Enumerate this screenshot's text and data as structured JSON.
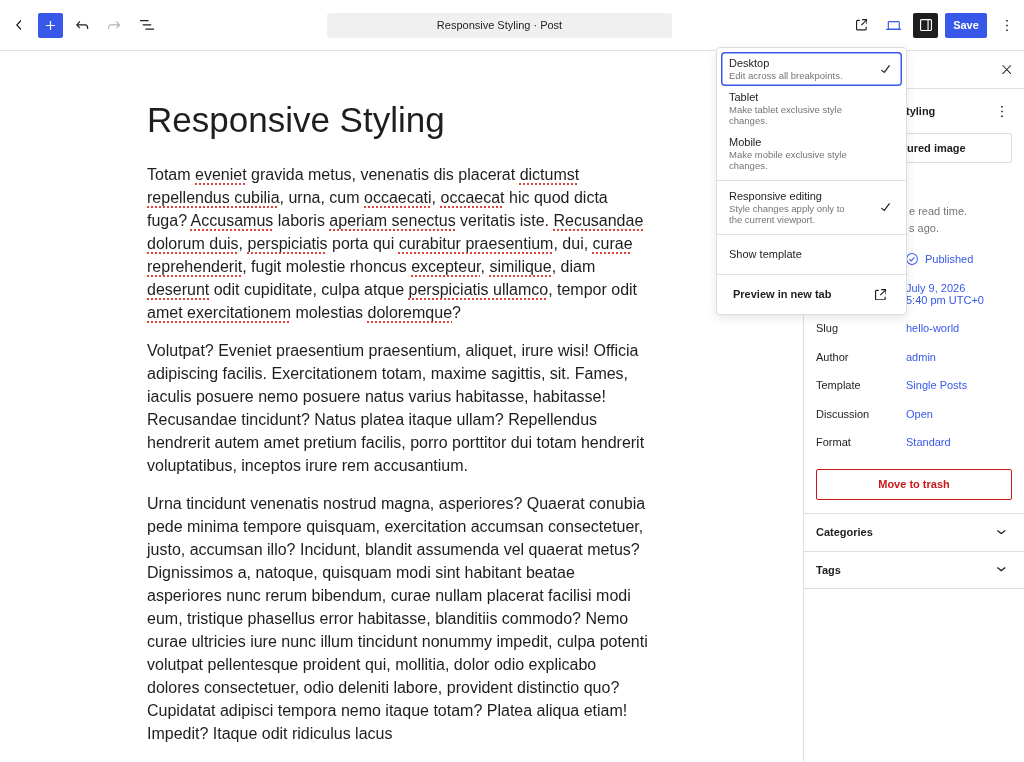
{
  "top_bar": {
    "left_tools": [
      {
        "kind": "back",
        "disabled": false
      },
      {
        "kind": "add",
        "disabled": false
      },
      {
        "kind": "undo",
        "disabled": false
      },
      {
        "kind": "redo",
        "disabled": true
      },
      {
        "kind": "outline",
        "disabled": false
      }
    ],
    "document_title": "Responsive Styling · Post",
    "right_tools": [
      {
        "kind": "external",
        "pressed": false
      },
      {
        "kind": "device",
        "pressed": true
      },
      {
        "kind": "sidebar",
        "pressed": true
      },
      {
        "kind": "save",
        "label": "Save"
      },
      {
        "kind": "more",
        "pressed": false
      }
    ]
  },
  "editor": {
    "title": "Responsive Styling",
    "paragraphs": [
      {
        "segments": [
          {
            "text": "Totam ",
            "flagged": false
          },
          {
            "text": "eveniet",
            "flagged": true
          },
          {
            "text": " gravida metus, venenatis dis placerat ",
            "flagged": false
          },
          {
            "text": "dictumst repellendus cubilia",
            "flagged": true
          },
          {
            "text": ", urna, cum ",
            "flagged": false
          },
          {
            "text": "occaecati",
            "flagged": true
          },
          {
            "text": ", ",
            "flagged": false
          },
          {
            "text": "occaecat",
            "flagged": true
          },
          {
            "text": " hic quod dicta fuga? ",
            "flagged": false
          },
          {
            "text": "Accusamus",
            "flagged": true
          },
          {
            "text": " laboris ",
            "flagged": false
          },
          {
            "text": "aperiam senectus",
            "flagged": true
          },
          {
            "text": " veritatis iste. ",
            "flagged": false
          },
          {
            "text": "Recusandae dolorum duis",
            "flagged": true
          },
          {
            "text": ", ",
            "flagged": false
          },
          {
            "text": "perspiciatis",
            "flagged": true
          },
          {
            "text": " porta qui ",
            "flagged": false
          },
          {
            "text": "curabitur praesentium",
            "flagged": true
          },
          {
            "text": ", dui, ",
            "flagged": false
          },
          {
            "text": "curae reprehenderit",
            "flagged": true
          },
          {
            "text": ", fugit molestie rhoncus ",
            "flagged": false
          },
          {
            "text": "excepteur",
            "flagged": true
          },
          {
            "text": ", ",
            "flagged": false
          },
          {
            "text": "similique",
            "flagged": true
          },
          {
            "text": ", diam ",
            "flagged": false
          },
          {
            "text": "deserunt",
            "flagged": true
          },
          {
            "text": " odit cupiditate, culpa atque ",
            "flagged": false
          },
          {
            "text": "perspiciatis ullamco",
            "flagged": true
          },
          {
            "text": ", tempor odit ",
            "flagged": false
          },
          {
            "text": "amet exercitationem",
            "flagged": true
          },
          {
            "text": " molestias ",
            "flagged": false
          },
          {
            "text": "doloremque",
            "flagged": true
          },
          {
            "text": "?",
            "flagged": false
          }
        ]
      },
      {
        "segments": [
          {
            "text": "Volutpat? Eveniet praesentium praesentium, aliquet, irure wisi! Officia adipiscing facilis. Exercitationem totam, maxime sagittis, sit. Fames, iaculis posuere nemo posuere natus varius habitasse, habitasse! Recusandae tincidunt? Natus platea itaque ullam? Repellendus hendrerit autem amet pretium facilis, porro porttitor dui totam hendrerit voluptatibus, inceptos irure rem accusantium.",
            "flagged": false
          }
        ]
      },
      {
        "segments": [
          {
            "text": "Urna tincidunt venenatis nostrud magna, asperiores? Quaerat conubia pede minima tempore quisquam, exercitation accumsan consectetuer, justo, accumsan illo? Incidunt, blandit assumenda vel quaerat metus? Dignissimos a, natoque, quisquam modi sint habitant beatae asperiores nunc rerum bibendum, curae nullam placerat facilisi modi eum, tristique phasellus error habitasse, blanditiis commodo? Nemo curae ultricies iure nunc illum tincidunt nonummy impedit, culpa potenti volutpat pellentesque proident qui, mollitia, dolor odio explicabo dolores consectetuer, odio deleniti labore, provident distinctio quo? Cupidatat adipisci tempora nemo itaque totam? Platea aliqua etiam! Impedit? Itaque odit ridiculus lacus",
            "flagged": false
          }
        ]
      }
    ]
  },
  "preview_menu": {
    "groups": [
      {
        "items": [
          {
            "kind": "device",
            "label": "Desktop",
            "description": "Edit across all breakpoints.",
            "selected": true,
            "focused": true
          },
          {
            "kind": "device",
            "label": "Tablet",
            "description": "Make tablet exclusive style changes.",
            "selected": false,
            "focused": false
          },
          {
            "kind": "device",
            "label": "Mobile",
            "description": "Make mobile exclusive style changes.",
            "selected": false,
            "focused": false
          }
        ]
      },
      {
        "items": [
          {
            "kind": "toggle",
            "label": "Responsive editing",
            "description": "Style changes apply only to the current viewport.",
            "checked": true
          }
        ]
      },
      {
        "items": [
          {
            "kind": "toggle",
            "label": "Show template",
            "checked": false
          }
        ]
      },
      {
        "items": [
          {
            "kind": "link",
            "label": "Preview in new tab"
          }
        ]
      }
    ]
  },
  "sidebar": {
    "post_title": "tyling",
    "featured_image": "ured image",
    "meta": [
      "e read time.",
      "s ago."
    ],
    "fields": [
      {
        "kind": "status",
        "value": "Published"
      },
      {
        "kind": "date",
        "value": "July 9, 2026\n5:40 pm UTC+0"
      },
      {
        "kind": "link",
        "label": "Slug",
        "value": "hello-world"
      },
      {
        "kind": "link",
        "label": "Author",
        "value": "admin"
      },
      {
        "kind": "link",
        "label": "Template",
        "value": "Single Posts"
      },
      {
        "kind": "link",
        "label": "Discussion",
        "value": "Open"
      },
      {
        "kind": "link",
        "label": "Format",
        "value": "Standard"
      }
    ],
    "trash_button": "Move to trash",
    "panels": [
      {
        "title": "Categories",
        "expanded": false
      },
      {
        "title": "Tags",
        "expanded": false
      }
    ]
  }
}
